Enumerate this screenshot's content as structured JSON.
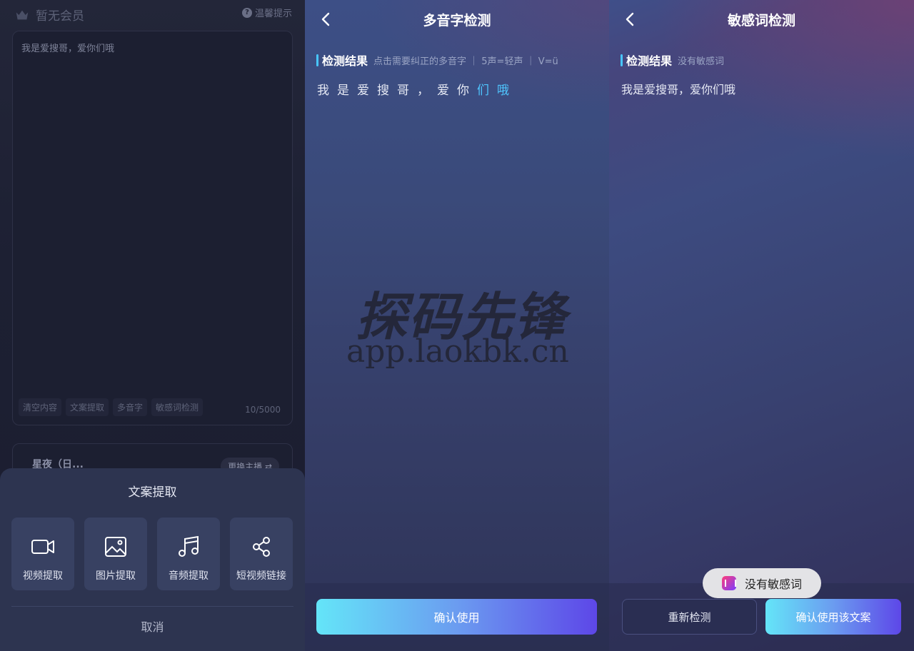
{
  "left": {
    "member_label": "暂无会员",
    "tip_label": "温馨提示",
    "editor_text": "我是爱搜哥，爱你们哦",
    "tools": [
      "清空内容",
      "文案提取",
      "多音字",
      "敏感词检测"
    ],
    "count": "10/5000",
    "voice_name": "星夜（日...",
    "voice_switch": "更换主播 ⇄",
    "sheet": {
      "title": "文案提取",
      "items": [
        {
          "label": "视频提取",
          "icon": "video-icon"
        },
        {
          "label": "图片提取",
          "icon": "image-icon"
        },
        {
          "label": "音频提取",
          "icon": "music-icon"
        },
        {
          "label": "短视频链接",
          "icon": "share-icon"
        }
      ],
      "cancel": "取消"
    }
  },
  "poly": {
    "title": "多音字检测",
    "result_label": "检测结果",
    "result_hint": "点击需要纠正的多音字 ｜ 5声=轻声 ｜ V=ü",
    "chars": [
      {
        "c": "我",
        "hl": false
      },
      {
        "c": "是",
        "hl": false
      },
      {
        "c": "爱",
        "hl": false
      },
      {
        "c": "搜",
        "hl": false
      },
      {
        "c": "哥",
        "hl": false
      },
      {
        "c": "，",
        "hl": false
      },
      {
        "c": "爱",
        "hl": false
      },
      {
        "c": "你",
        "hl": false
      },
      {
        "c": "们",
        "hl": true
      },
      {
        "c": "哦",
        "hl": true
      }
    ],
    "confirm": "确认使用"
  },
  "sens": {
    "title": "敏感词检测",
    "result_label": "检测结果",
    "result_hint": "没有敏感词",
    "text": "我是爱搜哥，爱你们哦",
    "recheck": "重新检测",
    "confirm": "确认使用该文案",
    "toast": "没有敏感词"
  },
  "watermark": {
    "logo": "探码先锋",
    "url": "app.laokbk.cn"
  },
  "colors": {
    "accent": "#4fc6ff",
    "button_start": "#64e5f8",
    "button_end": "#5d47e8"
  }
}
